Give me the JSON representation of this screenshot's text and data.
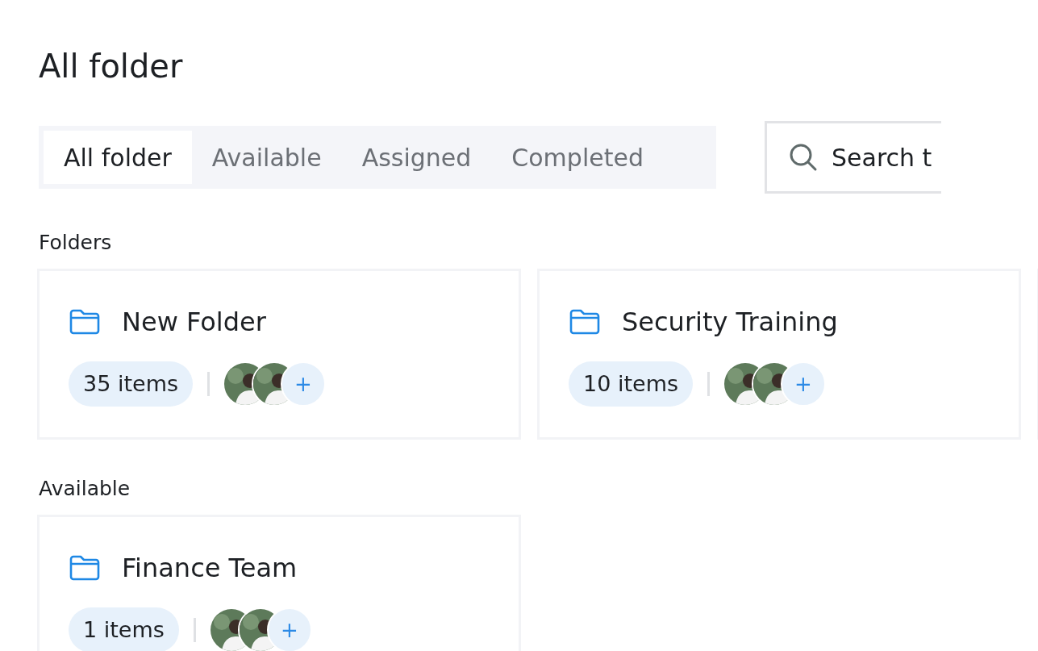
{
  "page_title": "All folder",
  "tabs": [
    {
      "label": "All folder",
      "selected": true
    },
    {
      "label": "Available",
      "selected": false
    },
    {
      "label": "Assigned",
      "selected": false
    },
    {
      "label": "Completed",
      "selected": false
    }
  ],
  "search": {
    "placeholder": "Search t"
  },
  "sections": [
    {
      "title": "Folders",
      "folders": [
        {
          "name": "New Folder",
          "count": "35 items",
          "add_label": "+"
        },
        {
          "name": "Security Training",
          "count": "10 items",
          "add_label": "+"
        }
      ]
    },
    {
      "title": "Available",
      "folders": [
        {
          "name": "Finance Team",
          "count": "1 items",
          "add_label": "+"
        }
      ]
    }
  ]
}
